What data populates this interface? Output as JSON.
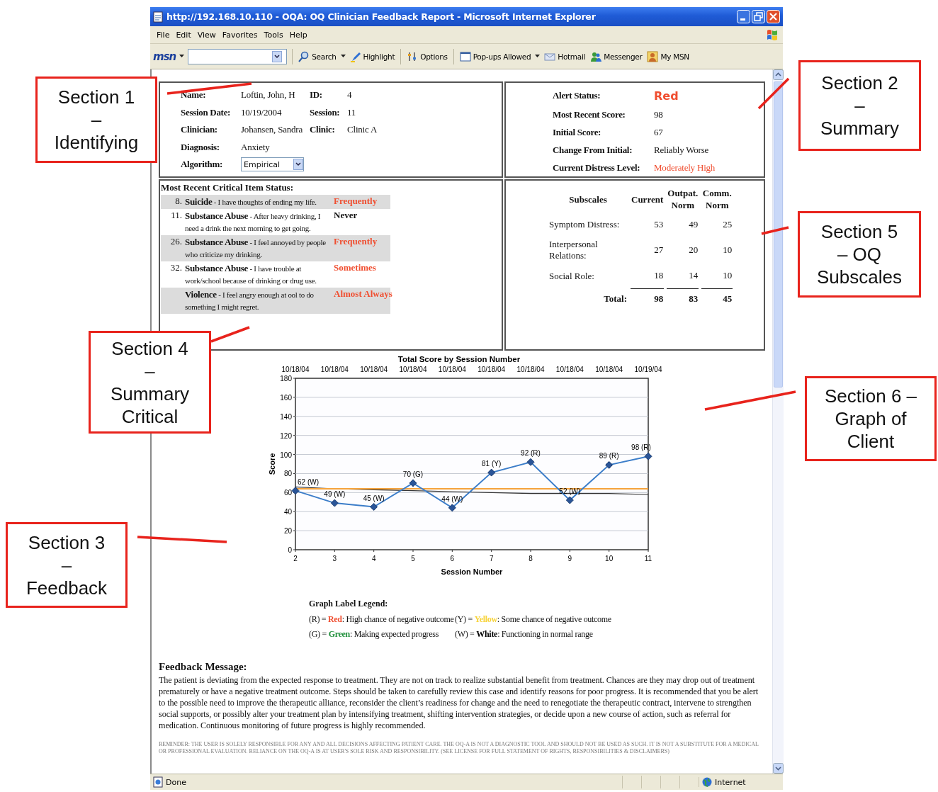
{
  "window": {
    "title": "http://192.168.10.110 - OQA: OQ Clinician Feedback Report - Microsoft Internet Explorer"
  },
  "menu": [
    "File",
    "Edit",
    "View",
    "Favorites",
    "Tools",
    "Help"
  ],
  "toolbar": {
    "logo": "msn",
    "buttons": [
      {
        "label": "Search",
        "kind": "search"
      },
      {
        "label": "Highlight",
        "kind": "highlight"
      },
      {
        "label": "Options",
        "kind": "options"
      },
      {
        "label": "Pop-ups Allowed",
        "kind": "popups"
      },
      {
        "label": "Hotmail",
        "kind": "hotmail"
      },
      {
        "label": "Messenger",
        "kind": "messenger"
      },
      {
        "label": "My MSN",
        "kind": "mymsn"
      }
    ]
  },
  "identifying": {
    "rows": [
      {
        "label": "Name:",
        "value": "Loftin, John, H",
        "label2": "ID:",
        "value2": "4"
      },
      {
        "label": "Session Date:",
        "value": "10/19/2004",
        "label2": "Session:",
        "value2": "11"
      },
      {
        "label": "Clinician:",
        "value": "Johansen, Sandra",
        "label2": "Clinic:",
        "value2": "Clinic A"
      },
      {
        "label": "Diagnosis:",
        "value": "Anxiety"
      }
    ],
    "algorithm": {
      "label": "Algorithm:",
      "value": "Empirical"
    }
  },
  "summary": {
    "alert_status": {
      "label": "Alert Status:",
      "value": "Red",
      "color": "#f04e30"
    },
    "rows": [
      {
        "label": "Most Recent Score:",
        "value": "98",
        "alert": false
      },
      {
        "label": "Initial Score:",
        "value": "67",
        "alert": false
      },
      {
        "label": "Change From Initial:",
        "value": "Reliably Worse",
        "alert": false
      },
      {
        "label": "Current Distress Level:",
        "value": "Moderately High",
        "alert": true
      }
    ]
  },
  "critical_items": {
    "title": "Most Recent Critical Item Status:",
    "items": [
      {
        "number": "8.",
        "category": "Suicide",
        "description": "- I have thoughts of ending my life.",
        "response": "Frequently",
        "flagged": true,
        "shaded": true
      },
      {
        "number": "11.",
        "category": "Substance Abuse",
        "description": "- After heavy drinking, I need a drink the next morning to get going.",
        "response": "Never",
        "flagged": false,
        "shaded": false
      },
      {
        "number": "26.",
        "category": "Substance Abuse",
        "description": "- I feel annoyed by people who criticize my drinking.",
        "response": "Frequently",
        "flagged": true,
        "shaded": true
      },
      {
        "number": "32.",
        "category": "Substance Abuse",
        "description": "- I have trouble at work/school because of drinking or drug use.",
        "response": "Sometimes",
        "flagged": true,
        "shaded": false
      },
      {
        "category": "Violence",
        "description": "- I feel angry enough at ool to do something I might regret.",
        "response": "Almost Always",
        "flagged": true,
        "shaded": true
      }
    ]
  },
  "subscales": {
    "columns": [
      "Subscales",
      "Current",
      "Outpat. Norm",
      "Comm. Norm"
    ],
    "rows": [
      {
        "name": "Symptom Distress:",
        "values": [
          "53",
          "49",
          "25"
        ]
      },
      {
        "name": "Interpersonal Relations:",
        "values": [
          "27",
          "20",
          "10"
        ]
      },
      {
        "name": "Social Role:",
        "values": [
          "18",
          "14",
          "10"
        ]
      }
    ],
    "total": {
      "label": "Total:",
      "values": [
        "98",
        "83",
        "45"
      ]
    }
  },
  "graph": {
    "session_dates": [
      "10/18/04",
      "10/18/04",
      "10/18/04",
      "10/18/04",
      "10/18/04",
      "10/18/04",
      "10/18/04",
      "10/18/04",
      "10/18/04",
      "10/19/04"
    ],
    "chart_data": {
      "type": "line",
      "title": "Total Score by Session Number",
      "xlabel": "Session Number",
      "ylabel": "Score",
      "x": [
        2,
        3,
        4,
        5,
        6,
        7,
        8,
        9,
        10,
        11
      ],
      "series": [
        {
          "color": "#3b7dc9",
          "marker": "diamond",
          "values": [
            62,
            49,
            45,
            70,
            44,
            81,
            92,
            52,
            89,
            98
          ]
        },
        {
          "color": "#f5a33c",
          "values": [
            64,
            64,
            64,
            64,
            64,
            64,
            64,
            64,
            64,
            64
          ]
        },
        {
          "color": "#333333",
          "values": [
            66,
            64,
            63,
            62,
            61,
            60,
            59,
            59,
            59,
            58
          ]
        }
      ],
      "xlim": [
        2,
        11
      ],
      "ylim": [
        0,
        180
      ],
      "grid": true,
      "yticks": [
        0,
        20,
        40,
        60,
        80,
        100,
        120,
        140,
        160,
        180
      ],
      "xticks": [
        {
          "value": 2,
          "label": "2"
        },
        {
          "value": 3,
          "label": "3"
        },
        {
          "value": 4,
          "label": "4"
        },
        {
          "value": 5,
          "label": "5"
        },
        {
          "value": 6,
          "label": "6"
        },
        {
          "value": 7,
          "label": "7"
        },
        {
          "value": 8,
          "label": "8"
        },
        {
          "value": 9,
          "label": "9"
        },
        {
          "value": 10,
          "label": "10"
        },
        {
          "value": 11,
          "label": "11"
        }
      ],
      "value_labels": [
        "62 (W)",
        "49 (W)",
        "45 (W)",
        "70 (G)",
        "44 (W)",
        "81 (Y)",
        "92 (R)",
        "52 (W)",
        "89 (R)",
        "98 (R)"
      ]
    }
  },
  "legend": {
    "title": "Graph Label Legend:",
    "entries": [
      {
        "code": "(R) =",
        "name": "Red",
        "color": "#f04e30",
        "meaning": ": High chance of negative outcome"
      },
      {
        "code": "(Y) =",
        "name": "Yellow",
        "color": "#f7d33a",
        "meaning": ": Some chance of negative outcome"
      },
      {
        "code": "(G) =",
        "name": "Green",
        "color": "#1e8f3a",
        "meaning": ": Making expected progress"
      },
      {
        "code": "(W) =",
        "name": "White",
        "color": "#000000",
        "meaning": ": Functioning in normal range"
      }
    ]
  },
  "feedback": {
    "title": "Feedback Message:",
    "message": "The patient is deviating from the expected response to treatment. They are not on track to realize substantial benefit from treatment. Chances are they may drop out of treatment prematurely or have a negative treatment outcome. Steps should be taken to carefully review this case and identify reasons for poor progress. It is recommended that you be alert to the possible need to improve the therapeutic alliance, reconsider the client’s readiness for change and the need to renegotiate the therapeutic contract, intervene to strengthen social supports, or possibly alter your treatment plan by intensifying treatment, shifting intervention strategies, or decide upon a new course of action, such as referral for medication. Continuous monitoring of future progress is highly recommended."
  },
  "disclaimer": "REMINDER: THE USER IS SOLELY RESPONSIBLE FOR ANY AND ALL DECISIONS AFFECTING PATIENT CARE. THE OQ-A IS NOT A DIAGNOSTIC TOOL AND SHOULD NOT BE USED AS SUCH. IT IS NOT A SUBSTITUTE FOR A MEDICAL OR PROFESSIONAL EVALUATION. RELIANCE ON THE OQ-A IS AT USER'S SOLE RISK AND RESPONSIBILITY. (SEE LICENSE FOR FULL STATEMENT OF RIGHTS, RESPONSIBILITIES & DISCLAIMERS)",
  "status_bar": {
    "status": "Done",
    "zone": "Internet"
  },
  "callouts": [
    {
      "lines": [
        "Section 1",
        "–",
        "Identifying"
      ]
    },
    {
      "lines": [
        "Section 2",
        "–",
        "Summary"
      ]
    },
    {
      "lines": [
        "Section 5",
        "– OQ",
        "Subscales"
      ]
    },
    {
      "lines": [
        "Section 4",
        "–",
        "Summary",
        "Critical"
      ]
    },
    {
      "lines": [
        "Section 6 –",
        "Graph of",
        "Client"
      ]
    },
    {
      "lines": [
        "Section 3",
        "–",
        "Feedback"
      ]
    }
  ]
}
